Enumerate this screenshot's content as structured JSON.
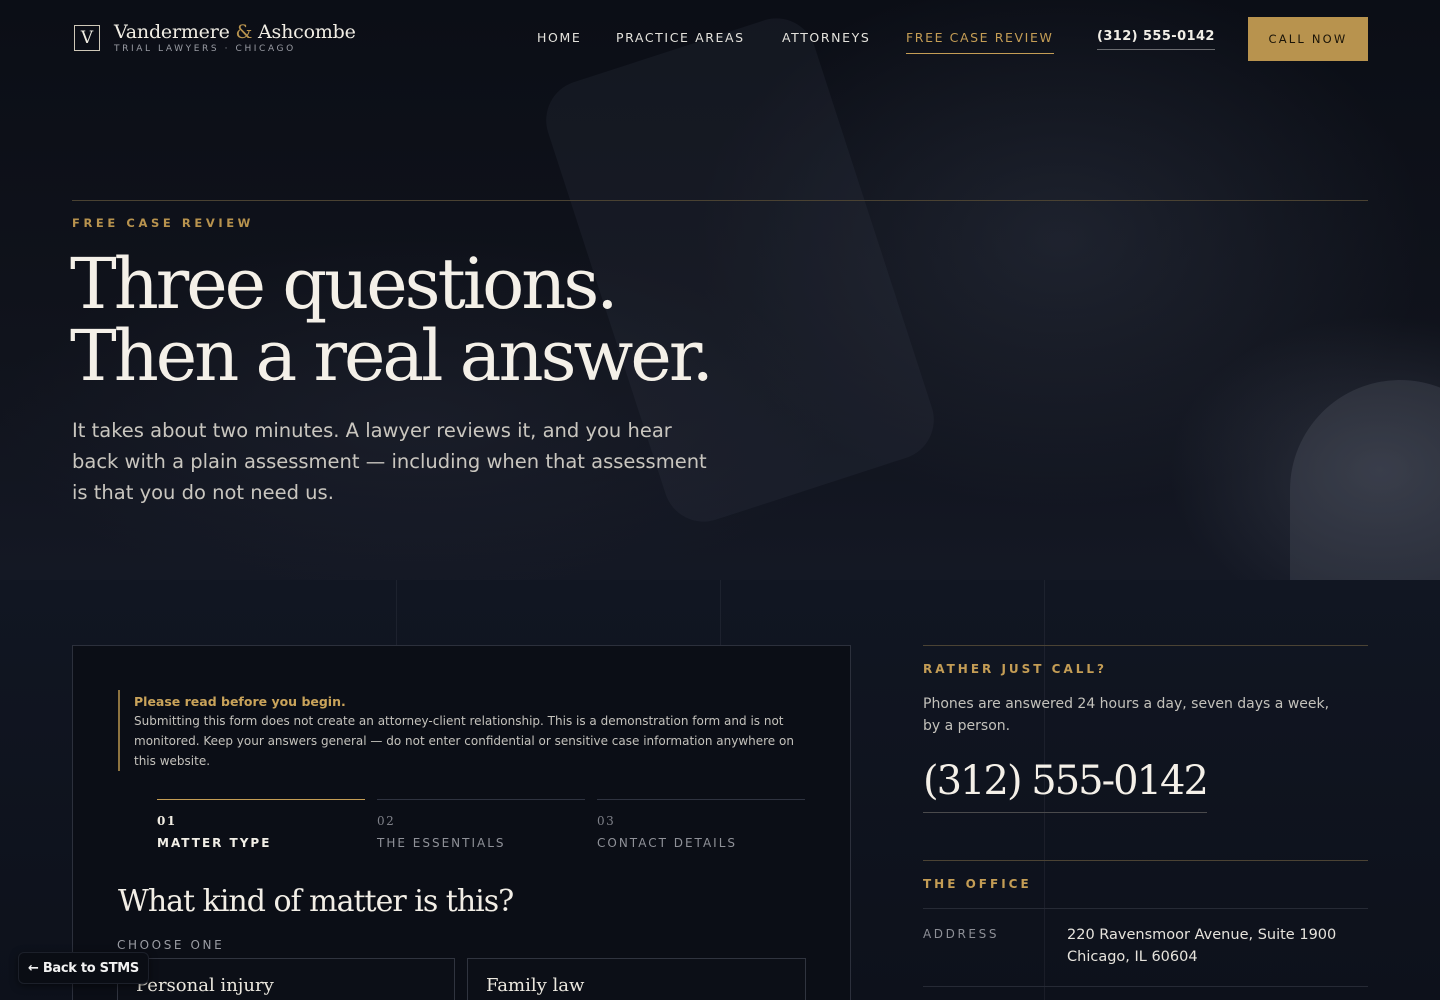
{
  "brand": {
    "mark": "V",
    "name_part1": "Vandermere",
    "amp": "&",
    "name_part2": "Ashcombe",
    "tagline": "TRIAL LAWYERS · CHICAGO"
  },
  "nav": {
    "items": [
      "HOME",
      "PRACTICE AREAS",
      "ATTORNEYS",
      "FREE CASE REVIEW"
    ],
    "active": "FREE CASE REVIEW",
    "phone": "(312) 555-0142",
    "cta": "CALL NOW"
  },
  "hero": {
    "eyebrow": "FREE CASE REVIEW",
    "title_line1": "Three questions.",
    "title_line2": "Then a real answer.",
    "lede": "It takes about two minutes. A lawyer reviews it, and you hear back with a plain assessment — including when that assessment is that you do not need us."
  },
  "notice": {
    "title": "Please read before you begin.",
    "body": "Submitting this form does not create an attorney-client relationship. This is a demonstration form and is not monitored. Keep your answers general — do not enter confidential or sensitive case information anywhere on this website."
  },
  "steps": [
    {
      "num": "01",
      "label": "MATTER TYPE"
    },
    {
      "num": "02",
      "label": "THE ESSENTIALS"
    },
    {
      "num": "03",
      "label": "CONTACT DETAILS"
    }
  ],
  "question": {
    "title": "What kind of matter is this?",
    "hint": "CHOOSE ONE",
    "options": [
      "Personal injury",
      "Family law"
    ]
  },
  "sidebar": {
    "call_eyebrow": "RATHER JUST CALL?",
    "call_text": "Phones are answered 24 hours a day, seven days a week, by a person.",
    "phone": "(312) 555-0142",
    "office_eyebrow": "THE OFFICE",
    "address_label": "ADDRESS",
    "address_line1": "220 Ravensmoor Avenue, Suite 1900",
    "address_line2": "Chicago, IL 60604"
  },
  "back_button": "← Back to STMS",
  "colors": {
    "gold": "#b8934e",
    "background": "#0a0d14",
    "text": "#f2eee6"
  }
}
